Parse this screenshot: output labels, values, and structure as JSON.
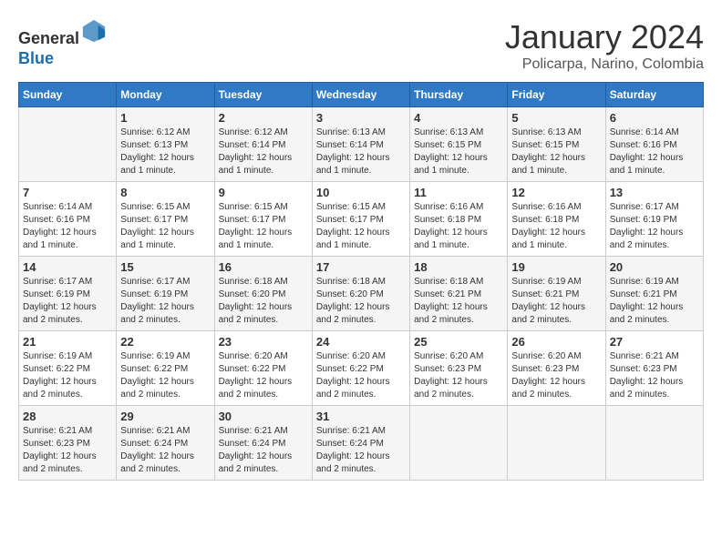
{
  "header": {
    "logo_general": "General",
    "logo_blue": "Blue",
    "month_title": "January 2024",
    "location": "Policarpa, Narino, Colombia"
  },
  "calendar": {
    "days_of_week": [
      "Sunday",
      "Monday",
      "Tuesday",
      "Wednesday",
      "Thursday",
      "Friday",
      "Saturday"
    ],
    "weeks": [
      [
        {
          "day": "",
          "info": ""
        },
        {
          "day": "1",
          "info": "Sunrise: 6:12 AM\nSunset: 6:13 PM\nDaylight: 12 hours\nand 1 minute."
        },
        {
          "day": "2",
          "info": "Sunrise: 6:12 AM\nSunset: 6:14 PM\nDaylight: 12 hours\nand 1 minute."
        },
        {
          "day": "3",
          "info": "Sunrise: 6:13 AM\nSunset: 6:14 PM\nDaylight: 12 hours\nand 1 minute."
        },
        {
          "day": "4",
          "info": "Sunrise: 6:13 AM\nSunset: 6:15 PM\nDaylight: 12 hours\nand 1 minute."
        },
        {
          "day": "5",
          "info": "Sunrise: 6:13 AM\nSunset: 6:15 PM\nDaylight: 12 hours\nand 1 minute."
        },
        {
          "day": "6",
          "info": "Sunrise: 6:14 AM\nSunset: 6:16 PM\nDaylight: 12 hours\nand 1 minute."
        }
      ],
      [
        {
          "day": "7",
          "info": "Sunrise: 6:14 AM\nSunset: 6:16 PM\nDaylight: 12 hours\nand 1 minute."
        },
        {
          "day": "8",
          "info": "Sunrise: 6:15 AM\nSunset: 6:17 PM\nDaylight: 12 hours\nand 1 minute."
        },
        {
          "day": "9",
          "info": "Sunrise: 6:15 AM\nSunset: 6:17 PM\nDaylight: 12 hours\nand 1 minute."
        },
        {
          "day": "10",
          "info": "Sunrise: 6:15 AM\nSunset: 6:17 PM\nDaylight: 12 hours\nand 1 minute."
        },
        {
          "day": "11",
          "info": "Sunrise: 6:16 AM\nSunset: 6:18 PM\nDaylight: 12 hours\nand 1 minute."
        },
        {
          "day": "12",
          "info": "Sunrise: 6:16 AM\nSunset: 6:18 PM\nDaylight: 12 hours\nand 1 minute."
        },
        {
          "day": "13",
          "info": "Sunrise: 6:17 AM\nSunset: 6:19 PM\nDaylight: 12 hours\nand 2 minutes."
        }
      ],
      [
        {
          "day": "14",
          "info": "Sunrise: 6:17 AM\nSunset: 6:19 PM\nDaylight: 12 hours\nand 2 minutes."
        },
        {
          "day": "15",
          "info": "Sunrise: 6:17 AM\nSunset: 6:19 PM\nDaylight: 12 hours\nand 2 minutes."
        },
        {
          "day": "16",
          "info": "Sunrise: 6:18 AM\nSunset: 6:20 PM\nDaylight: 12 hours\nand 2 minutes."
        },
        {
          "day": "17",
          "info": "Sunrise: 6:18 AM\nSunset: 6:20 PM\nDaylight: 12 hours\nand 2 minutes."
        },
        {
          "day": "18",
          "info": "Sunrise: 6:18 AM\nSunset: 6:21 PM\nDaylight: 12 hours\nand 2 minutes."
        },
        {
          "day": "19",
          "info": "Sunrise: 6:19 AM\nSunset: 6:21 PM\nDaylight: 12 hours\nand 2 minutes."
        },
        {
          "day": "20",
          "info": "Sunrise: 6:19 AM\nSunset: 6:21 PM\nDaylight: 12 hours\nand 2 minutes."
        }
      ],
      [
        {
          "day": "21",
          "info": "Sunrise: 6:19 AM\nSunset: 6:22 PM\nDaylight: 12 hours\nand 2 minutes."
        },
        {
          "day": "22",
          "info": "Sunrise: 6:19 AM\nSunset: 6:22 PM\nDaylight: 12 hours\nand 2 minutes."
        },
        {
          "day": "23",
          "info": "Sunrise: 6:20 AM\nSunset: 6:22 PM\nDaylight: 12 hours\nand 2 minutes."
        },
        {
          "day": "24",
          "info": "Sunrise: 6:20 AM\nSunset: 6:22 PM\nDaylight: 12 hours\nand 2 minutes."
        },
        {
          "day": "25",
          "info": "Sunrise: 6:20 AM\nSunset: 6:23 PM\nDaylight: 12 hours\nand 2 minutes."
        },
        {
          "day": "26",
          "info": "Sunrise: 6:20 AM\nSunset: 6:23 PM\nDaylight: 12 hours\nand 2 minutes."
        },
        {
          "day": "27",
          "info": "Sunrise: 6:21 AM\nSunset: 6:23 PM\nDaylight: 12 hours\nand 2 minutes."
        }
      ],
      [
        {
          "day": "28",
          "info": "Sunrise: 6:21 AM\nSunset: 6:23 PM\nDaylight: 12 hours\nand 2 minutes."
        },
        {
          "day": "29",
          "info": "Sunrise: 6:21 AM\nSunset: 6:24 PM\nDaylight: 12 hours\nand 2 minutes."
        },
        {
          "day": "30",
          "info": "Sunrise: 6:21 AM\nSunset: 6:24 PM\nDaylight: 12 hours\nand 2 minutes."
        },
        {
          "day": "31",
          "info": "Sunrise: 6:21 AM\nSunset: 6:24 PM\nDaylight: 12 hours\nand 2 minutes."
        },
        {
          "day": "",
          "info": ""
        },
        {
          "day": "",
          "info": ""
        },
        {
          "day": "",
          "info": ""
        }
      ]
    ]
  }
}
